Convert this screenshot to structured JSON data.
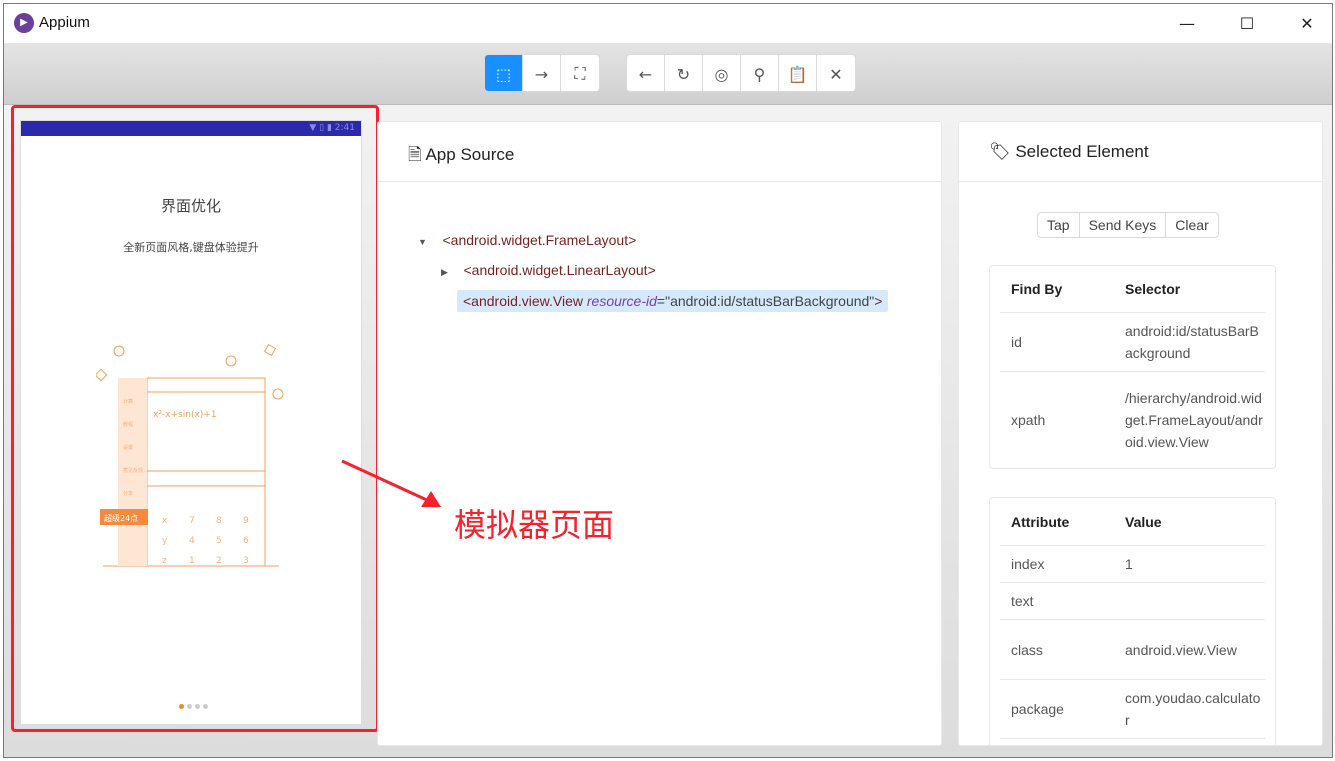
{
  "window": {
    "title": "Appium",
    "controls": [
      "minimize",
      "maximize",
      "close"
    ]
  },
  "toolbar": {
    "mode_buttons": [
      {
        "icon": "select-element-icon",
        "active": true
      },
      {
        "icon": "swipe-arrow-icon",
        "active": false
      },
      {
        "icon": "tap-coordinates-icon",
        "active": false
      }
    ],
    "action_buttons": [
      {
        "icon": "back-arrow-icon"
      },
      {
        "icon": "refresh-icon"
      },
      {
        "icon": "eye-icon"
      },
      {
        "icon": "search-icon"
      },
      {
        "icon": "clipboard-icon"
      },
      {
        "icon": "close-icon"
      }
    ]
  },
  "phone": {
    "status_time": "2:41",
    "title": "界面优化",
    "subtitle": "全新页面风格,键盘体验提升",
    "illustration": {
      "expression": "x²-x+sin(x)+1",
      "menu": [
        "计算",
        "教程",
        "设置",
        "意见反馈",
        "分享"
      ],
      "badge": "超级24点",
      "keys": [
        "x",
        "7",
        "8",
        "9",
        "y",
        "4",
        "5",
        "6",
        "z",
        "1",
        "2",
        "3"
      ]
    },
    "page_dots": 4,
    "active_dot": 1
  },
  "annotation": {
    "label": "模拟器页面",
    "color": "#f5222d"
  },
  "app_source": {
    "title": "App Source",
    "tree": [
      {
        "tag": "<android.widget.FrameLayout>",
        "expanded": true
      },
      {
        "tag": "<android.widget.LinearLayout>",
        "expanded": false
      },
      {
        "tag_open": "<android.view.View ",
        "attr_name": "resource-id",
        "attr_eq": "=",
        "attr_value": "\"android:id/statusBarBackground\"",
        "tag_close": ">",
        "selected": true
      }
    ]
  },
  "selected_element": {
    "title": "Selected Element",
    "actions": [
      "Tap",
      "Send Keys",
      "Clear"
    ],
    "find_by": {
      "headers": [
        "Find By",
        "Selector"
      ],
      "rows": [
        [
          "id",
          "android:id/statusBarBackground"
        ],
        [
          "xpath",
          "/hierarchy/android.widget.FrameLayout/android.view.View"
        ]
      ]
    },
    "attributes": {
      "headers": [
        "Attribute",
        "Value"
      ],
      "rows": [
        [
          "index",
          "1"
        ],
        [
          "text",
          ""
        ],
        [
          "class",
          "android.view.View"
        ],
        [
          "package",
          "com.youdao.calculator"
        ]
      ]
    }
  },
  "colors": {
    "accent": "#1890ff",
    "status_bar": "#2a2aab",
    "highlight": "#d4e9fb",
    "illustration": "#f5a05a"
  }
}
